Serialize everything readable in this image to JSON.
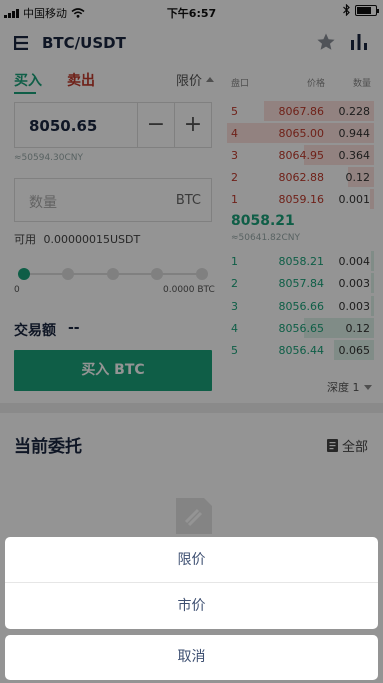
{
  "status_bar": {
    "carrier": "中国移动",
    "time": "下午6:57"
  },
  "header": {
    "pair": "BTC/USDT"
  },
  "order_form": {
    "tab_buy": "买入",
    "tab_sell": "卖出",
    "order_type": "限价",
    "price": "8050.65",
    "minus": "−",
    "plus": "+",
    "price_cny": "≈50594.30CNY",
    "quantity_placeholder": "数量",
    "quantity_unit": "BTC",
    "available_label": "可用",
    "available_value": "0.00000015USDT",
    "slider_progress": 0,
    "slider_min": "0",
    "slider_max": "0.0000 BTC",
    "amount_label": "交易额",
    "amount_value": "--",
    "buy_button": "买入 BTC"
  },
  "order_book": {
    "headers": {
      "level": "盘口",
      "price": "价格",
      "qty": "数量"
    },
    "asks": [
      {
        "level": "5",
        "price": "8067.86",
        "qty": "0.228"
      },
      {
        "level": "4",
        "price": "8065.00",
        "qty": "0.944"
      },
      {
        "level": "3",
        "price": "8064.95",
        "qty": "0.364"
      },
      {
        "level": "2",
        "price": "8062.88",
        "qty": "0.12"
      },
      {
        "level": "1",
        "price": "8059.16",
        "qty": "0.001"
      }
    ],
    "last_price": "8058.21",
    "last_price_cny": "≈50641.82CNY",
    "bids": [
      {
        "level": "1",
        "price": "8058.21",
        "qty": "0.004"
      },
      {
        "level": "2",
        "price": "8057.84",
        "qty": "0.003"
      },
      {
        "level": "3",
        "price": "8056.66",
        "qty": "0.003"
      },
      {
        "level": "4",
        "price": "8056.65",
        "qty": "0.12"
      },
      {
        "level": "5",
        "price": "8056.44",
        "qty": "0.065"
      }
    ],
    "depth": "深度 1"
  },
  "orders": {
    "title": "当前委托",
    "all": "全部"
  },
  "action_sheet": {
    "option_limit": "限价",
    "option_market": "市价",
    "cancel": "取消"
  },
  "colors": {
    "buy": "#1aa37a",
    "sell": "#c0392b",
    "text": "#1a2740"
  }
}
